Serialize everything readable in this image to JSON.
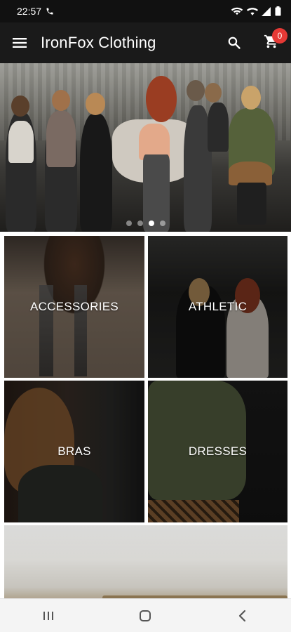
{
  "status_bar": {
    "time": "22:57",
    "icons": [
      "phone-call-icon",
      "wifi-calling-icon",
      "wifi-icon",
      "signal-icon",
      "battery-icon"
    ]
  },
  "app_bar": {
    "menu_icon": "hamburger-menu-icon",
    "title": "IronFox Clothing",
    "search_icon": "search-icon",
    "cart_icon": "shopping-cart-icon",
    "cart_count": "0"
  },
  "hero": {
    "slide_count": 4,
    "active_slide": 3
  },
  "categories": [
    {
      "label": "ACCESSORIES"
    },
    {
      "label": "ATHLETIC"
    },
    {
      "label": "BRAS"
    },
    {
      "label": "DRESSES"
    }
  ],
  "nav_bar": {
    "icons": [
      "recent-apps-icon",
      "home-icon",
      "back-icon"
    ]
  },
  "colors": {
    "app_bar": "#1a1a1a",
    "status_bar": "#111111",
    "badge": "#e53935",
    "nav_bar": "#f4f4f4"
  }
}
